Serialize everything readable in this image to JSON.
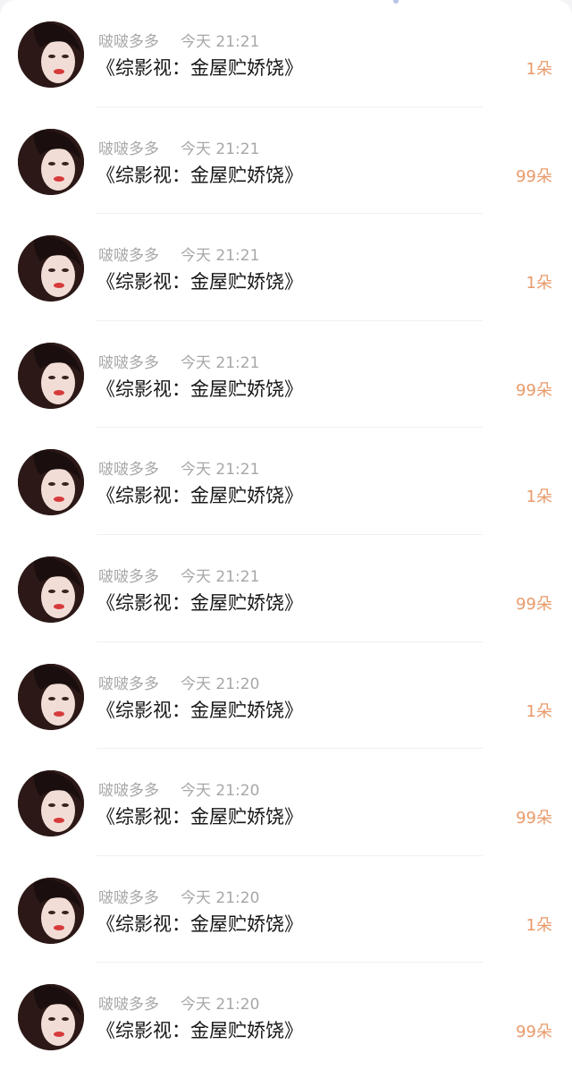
{
  "rows": [
    {
      "name": "啵啵多多",
      "time": "今天 21:21",
      "title": "《综影视：金屋贮娇饶》",
      "amount": "1朵"
    },
    {
      "name": "啵啵多多",
      "time": "今天 21:21",
      "title": "《综影视：金屋贮娇饶》",
      "amount": "99朵"
    },
    {
      "name": "啵啵多多",
      "time": "今天 21:21",
      "title": "《综影视：金屋贮娇饶》",
      "amount": "1朵"
    },
    {
      "name": "啵啵多多",
      "time": "今天 21:21",
      "title": "《综影视：金屋贮娇饶》",
      "amount": "99朵"
    },
    {
      "name": "啵啵多多",
      "time": "今天 21:21",
      "title": "《综影视：金屋贮娇饶》",
      "amount": "1朵"
    },
    {
      "name": "啵啵多多",
      "time": "今天 21:21",
      "title": "《综影视：金屋贮娇饶》",
      "amount": "99朵"
    },
    {
      "name": "啵啵多多",
      "time": "今天 21:20",
      "title": "《综影视：金屋贮娇饶》",
      "amount": "1朵"
    },
    {
      "name": "啵啵多多",
      "time": "今天 21:20",
      "title": "《综影视：金屋贮娇饶》",
      "amount": "99朵"
    },
    {
      "name": "啵啵多多",
      "time": "今天 21:20",
      "title": "《综影视：金屋贮娇饶》",
      "amount": "1朵"
    },
    {
      "name": "啵啵多多",
      "time": "今天 21:20",
      "title": "《综影视：金屋贮娇饶》",
      "amount": "99朵"
    }
  ],
  "colors": {
    "name_text": "#a7a7a7",
    "title_text": "#171717",
    "amount_text": "#e89a6a",
    "divider": "#f0f0f0",
    "top_indicator": "#b9c6e8"
  }
}
